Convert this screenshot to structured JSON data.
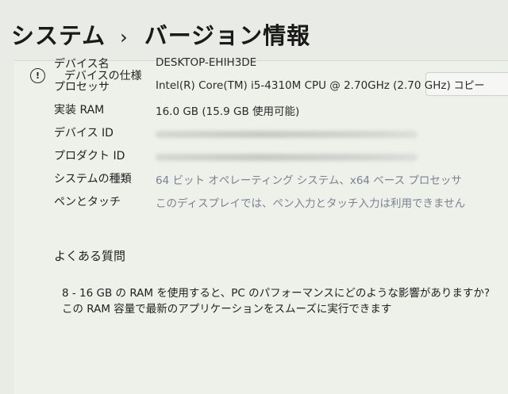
{
  "header": {
    "parent": "システム",
    "separator": "›",
    "title": "バージョン情報"
  },
  "device_specs": {
    "icon": "info-icon",
    "title": "デバイスの仕様",
    "copy_label": "コピー",
    "rows": [
      {
        "label": "デバイス名",
        "value": "DESKTOP-EHIH3DE"
      },
      {
        "label": "プロセッサ",
        "value": "Intel(R) Core(TM) i5-4310M CPU @ 2.70GHz (2.70 GHz)"
      },
      {
        "label": "実装 RAM",
        "value": "16.0 GB (15.9 GB 使用可能)"
      },
      {
        "label": "デバイス ID",
        "value": ""
      },
      {
        "label": "プロダクト ID",
        "value": ""
      },
      {
        "label": "システムの種類",
        "value": "64 ビット オペレーティング システム、x64 ベース プロセッサ"
      },
      {
        "label": "ペンとタッチ",
        "value": "このディスプレイでは、ペン入力とタッチ入力は利用できません"
      }
    ]
  },
  "faq": {
    "title": "よくある質問",
    "text": "8 - 16 GB の RAM を使用すると、PC のパフォーマンスにどのような影響がありますか?この RAM 容量で最新のアプリケーションをスムーズに実行できます"
  }
}
